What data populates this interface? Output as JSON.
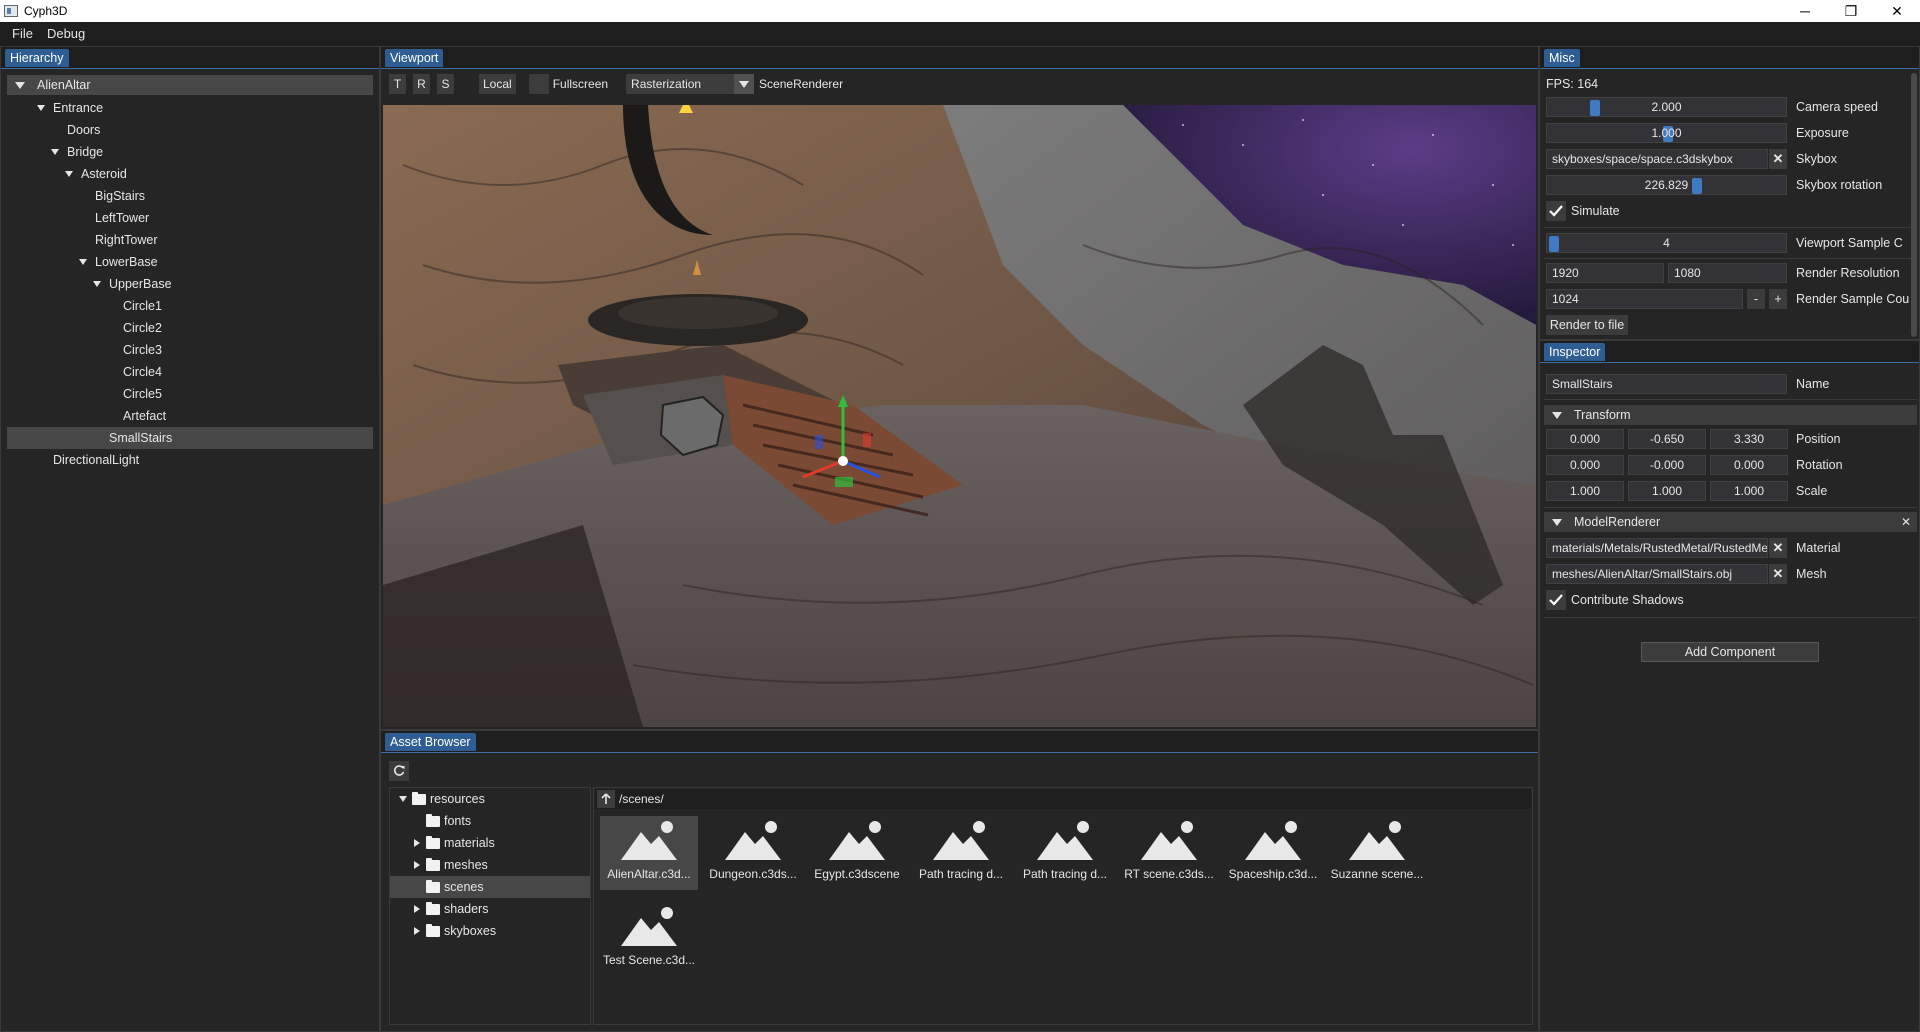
{
  "window": {
    "title": "Cyph3D",
    "minimize": "─",
    "maximize": "❐",
    "close": "✕"
  },
  "menu": {
    "items": [
      "File",
      "Debug"
    ]
  },
  "hierarchy": {
    "tab": "Hierarchy",
    "root": "AlienAltar",
    "items": [
      {
        "label": "Entrance",
        "depth": 0,
        "expanded": true
      },
      {
        "label": "Doors",
        "depth": 1,
        "expanded": null
      },
      {
        "label": "Bridge",
        "depth": 1,
        "expanded": true
      },
      {
        "label": "Asteroid",
        "depth": 2,
        "expanded": true
      },
      {
        "label": "BigStairs",
        "depth": 3,
        "expanded": null
      },
      {
        "label": "LeftTower",
        "depth": 3,
        "expanded": null
      },
      {
        "label": "RightTower",
        "depth": 3,
        "expanded": null
      },
      {
        "label": "LowerBase",
        "depth": 3,
        "expanded": true
      },
      {
        "label": "UpperBase",
        "depth": 4,
        "expanded": true
      },
      {
        "label": "Circle1",
        "depth": 5,
        "expanded": null
      },
      {
        "label": "Circle2",
        "depth": 5,
        "expanded": null
      },
      {
        "label": "Circle3",
        "depth": 5,
        "expanded": null
      },
      {
        "label": "Circle4",
        "depth": 5,
        "expanded": null
      },
      {
        "label": "Circle5",
        "depth": 5,
        "expanded": null
      },
      {
        "label": "Artefact",
        "depth": 5,
        "expanded": null
      },
      {
        "label": "SmallStairs",
        "depth": 4,
        "expanded": null,
        "selected": true
      },
      {
        "label": "DirectionalLight",
        "depth": 0,
        "expanded": null
      }
    ]
  },
  "viewport": {
    "tab": "Viewport",
    "gizmo_buttons": [
      "T",
      "R",
      "S"
    ],
    "space_button": "Local",
    "fullscreen_label": "Fullscreen",
    "renderer_mode": "Rasterization",
    "renderer_name": "SceneRenderer"
  },
  "asset_browser": {
    "tab": "Asset Browser",
    "path": "/scenes/",
    "folders": [
      {
        "label": "resources",
        "depth": 0,
        "state": "expanded"
      },
      {
        "label": "fonts",
        "depth": 1,
        "state": "leaf"
      },
      {
        "label": "materials",
        "depth": 1,
        "state": "collapsed"
      },
      {
        "label": "meshes",
        "depth": 1,
        "state": "collapsed"
      },
      {
        "label": "scenes",
        "depth": 1,
        "state": "leaf",
        "selected": true
      },
      {
        "label": "shaders",
        "depth": 1,
        "state": "collapsed"
      },
      {
        "label": "skyboxes",
        "depth": 1,
        "state": "collapsed"
      }
    ],
    "files": [
      {
        "label": "AlienAltar.c3d...",
        "selected": true
      },
      {
        "label": "Dungeon.c3ds..."
      },
      {
        "label": "Egypt.c3dscene"
      },
      {
        "label": "Path tracing d..."
      },
      {
        "label": "Path tracing d..."
      },
      {
        "label": "RT scene.c3ds..."
      },
      {
        "label": "Spaceship.c3d..."
      },
      {
        "label": "Suzanne scene..."
      },
      {
        "label": "Test Scene.c3d..."
      }
    ]
  },
  "misc": {
    "tab": "Misc",
    "fps": "FPS: 164",
    "camera_speed": {
      "value": "2.000",
      "label": "Camera speed",
      "fraction": 0.18
    },
    "exposure": {
      "value": "1.000",
      "label": "Exposure",
      "fraction": 0.5
    },
    "skybox": {
      "value": "skyboxes/space/space.c3dskybox",
      "label": "Skybox"
    },
    "skybox_rotation": {
      "value": "226.829",
      "label": "Skybox rotation",
      "fraction": 0.63
    },
    "simulate": {
      "label": "Simulate",
      "checked": true
    },
    "viewport_samples": {
      "value": "4",
      "label": "Viewport Sample C",
      "fraction": 0.0
    },
    "render_resolution": {
      "width": "1920",
      "height": "1080",
      "label": "Render Resolution"
    },
    "render_samples": {
      "value": "1024",
      "label": "Render Sample Cou",
      "minus": "-",
      "plus": "+"
    },
    "render_button": "Render to file"
  },
  "inspector": {
    "tab": "Inspector",
    "name": {
      "value": "SmallStairs",
      "label": "Name"
    },
    "transform": {
      "header": "Transform",
      "position": {
        "label": "Position",
        "x": "0.000",
        "y": "-0.650",
        "z": "3.330"
      },
      "rotation": {
        "label": "Rotation",
        "x": "0.000",
        "y": "-0.000",
        "z": "0.000"
      },
      "scale": {
        "label": "Scale",
        "x": "1.000",
        "y": "1.000",
        "z": "1.000"
      }
    },
    "model_renderer": {
      "header": "ModelRenderer",
      "close": "✕",
      "material": {
        "value": "materials/Metals/RustedMetal/RustedMe",
        "label": "Material"
      },
      "mesh": {
        "value": "meshes/AlienAltar/SmallStairs.obj",
        "label": "Mesh"
      },
      "contribute_shadows": {
        "label": "Contribute Shadows",
        "checked": true
      }
    },
    "add_component": "Add Component"
  },
  "colors": {
    "accent": "#2d5d92",
    "slider": "#3f7ac2",
    "background": "#252526",
    "field": "#333337"
  }
}
